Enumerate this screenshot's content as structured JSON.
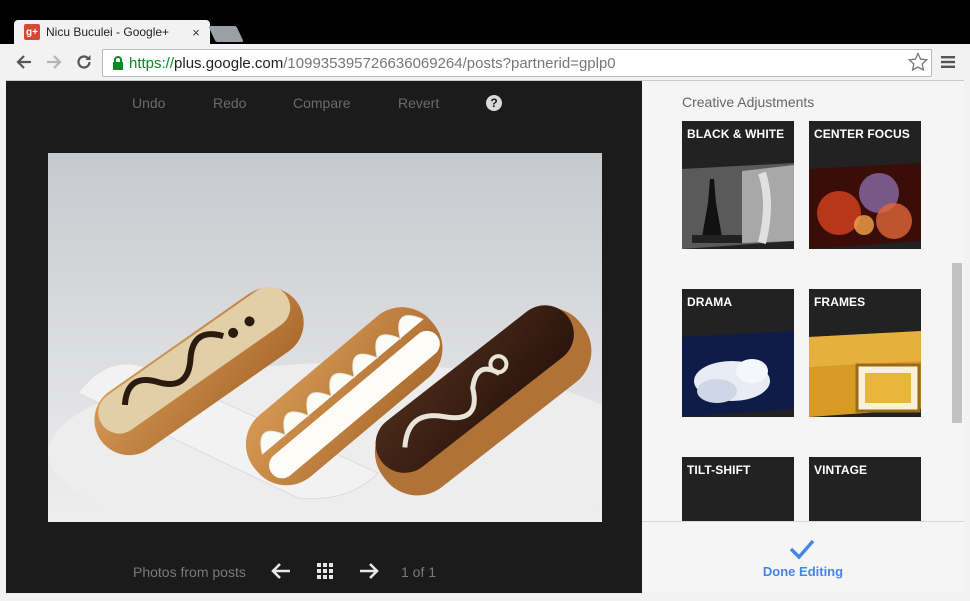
{
  "browser": {
    "tab_title": "Nicu Buculei - Google+",
    "favicon_text": "g+",
    "url_scheme": "https://",
    "url_host": "plus.google.com",
    "url_path": "/109935395726636069264/posts?partnerid=gplp0",
    "icons": [
      "back-arrow-icon",
      "forward-arrow-icon",
      "reload-icon",
      "lock-icon",
      "star-icon",
      "menu-icon"
    ]
  },
  "editor": {
    "undo": "Undo",
    "redo": "Redo",
    "compare": "Compare",
    "revert": "Revert",
    "help": "?"
  },
  "navigation": {
    "photos_from_posts": "Photos from posts",
    "counter": "1 of 1"
  },
  "panel": {
    "title": "Creative Adjustments",
    "filters": [
      {
        "label": "BLACK & WHITE"
      },
      {
        "label": "CENTER FOCUS"
      },
      {
        "label": "DRAMA"
      },
      {
        "label": "FRAMES"
      },
      {
        "label": "TILT-SHIFT"
      },
      {
        "label": "VINTAGE"
      }
    ],
    "done_label": "Done Editing"
  },
  "colors": {
    "accent": "#4486e8",
    "secure_green": "#0a8a25",
    "viewer_bg": "#1b1b1b",
    "panel_bg": "#f5f5f5"
  }
}
